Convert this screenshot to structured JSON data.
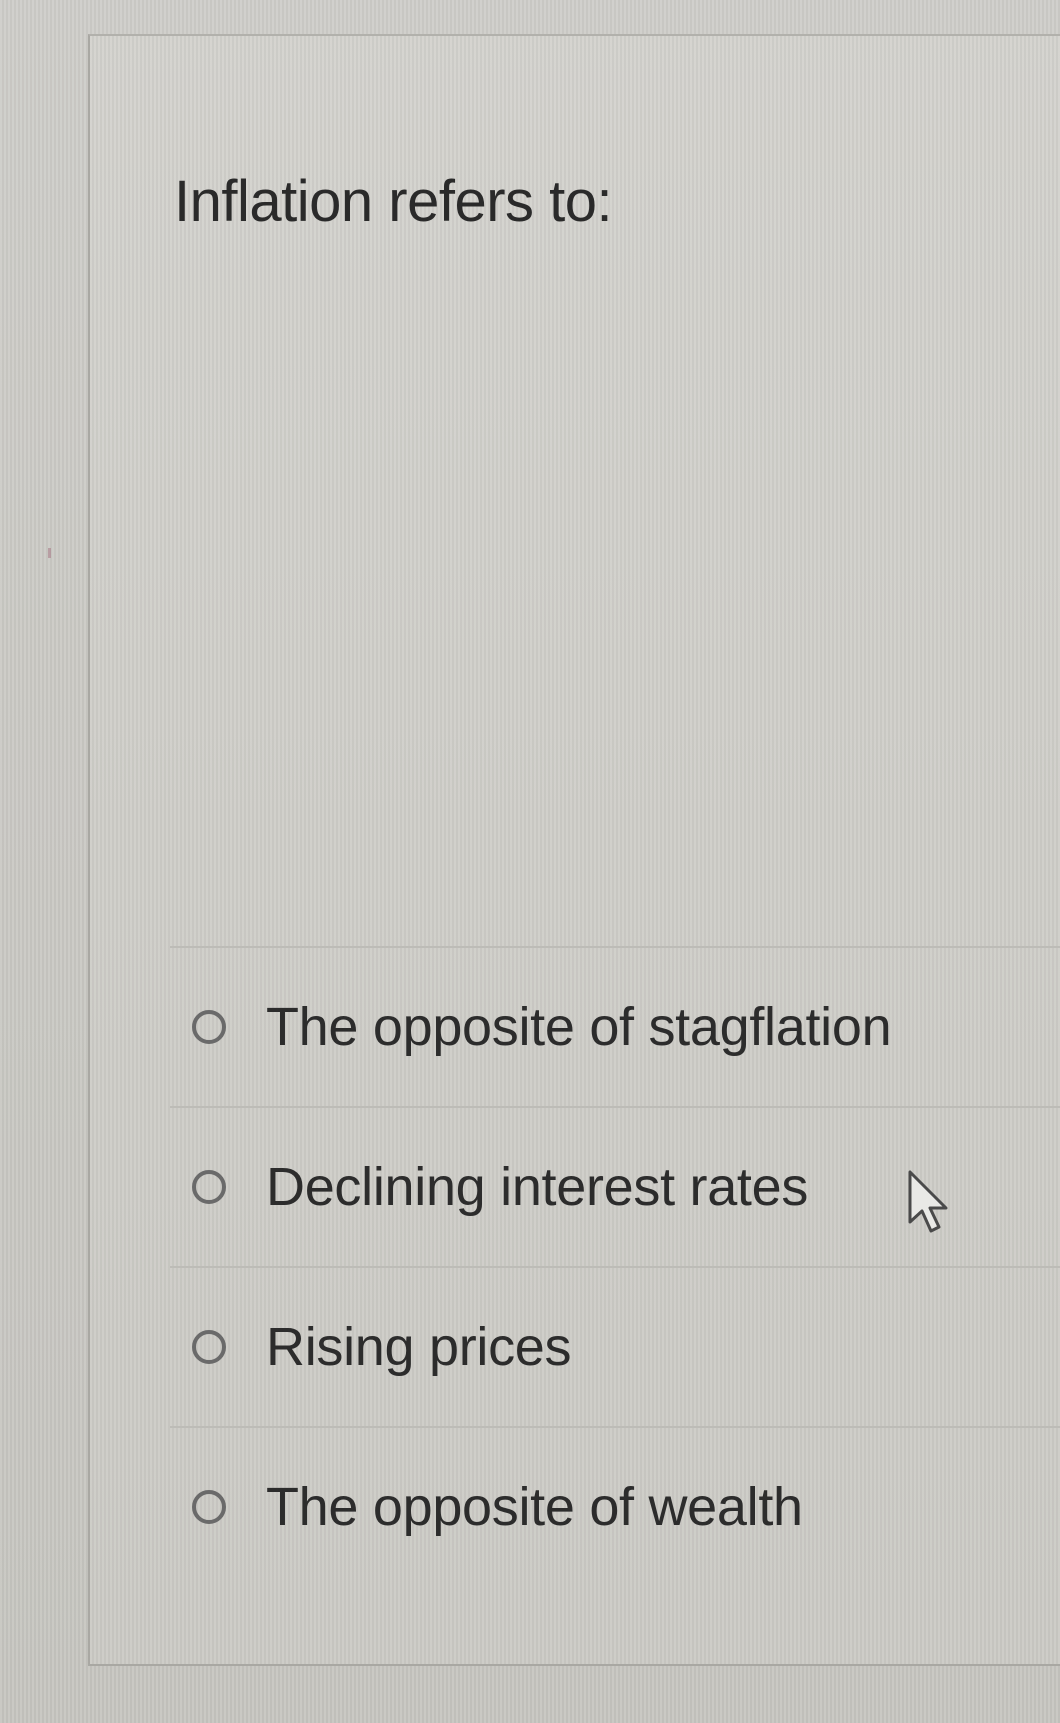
{
  "question": {
    "text": "Inflation refers to:"
  },
  "answers": [
    {
      "label": "The opposite of stagflation",
      "selected": false
    },
    {
      "label": "Declining interest rates",
      "selected": false
    },
    {
      "label": "Rising prices",
      "selected": false
    },
    {
      "label": "The opposite of wealth",
      "selected": false
    }
  ],
  "cursor": {
    "icon": "pointer-arrow-icon"
  }
}
